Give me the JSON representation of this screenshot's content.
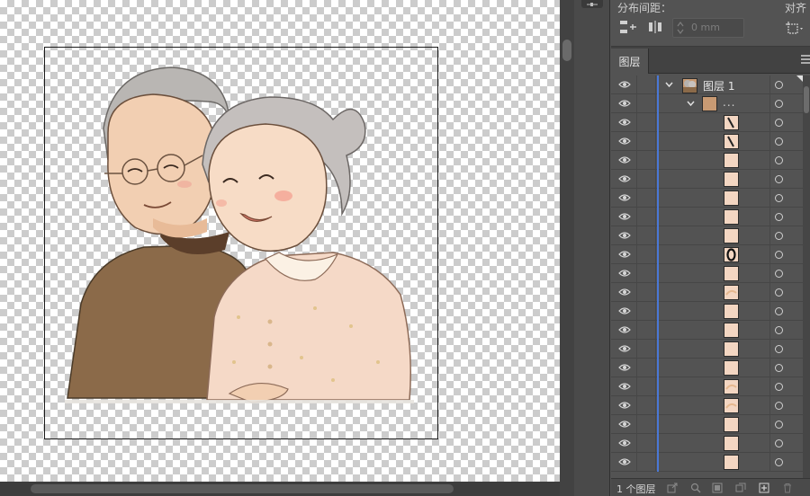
{
  "panel": {
    "distribute_spacing_title": "分布间距：",
    "align_to_title": "对齐",
    "spacing_value": "0 mm",
    "layers_tab": "图层",
    "layer_name": "图层 1",
    "group_name": "...",
    "layer_count": "1 个图层"
  },
  "icons": {
    "distribute_vertical": "distribute-vertical-space-icon",
    "distribute_horizontal": "distribute-horizontal-space-icon",
    "align_to": "align-to-artboard-icon",
    "visibility": "eye-icon",
    "target": "target-circle-icon",
    "footer": [
      "export-icon",
      "search-icon",
      "make-clipping-mask-icon",
      "new-sublayer-icon",
      "new-layer-icon",
      "delete-icon"
    ]
  },
  "colors": {
    "panel_bg": "#535353",
    "selection_bar": "#4a78d6",
    "thumbnail_skin": "#f3d6c2"
  },
  "layer_rows": [
    {
      "thumb": "stroke"
    },
    {
      "thumb": "stroke"
    },
    {
      "thumb": "fill"
    },
    {
      "thumb": "fill"
    },
    {
      "thumb": "fill"
    },
    {
      "thumb": "fill"
    },
    {
      "thumb": "fill"
    },
    {
      "thumb": "ring"
    },
    {
      "thumb": "fill"
    },
    {
      "thumb": "arc"
    },
    {
      "thumb": "fill"
    },
    {
      "thumb": "fill"
    },
    {
      "thumb": "fill"
    },
    {
      "thumb": "fill"
    },
    {
      "thumb": "arc"
    },
    {
      "thumb": "arc"
    },
    {
      "thumb": "fill"
    },
    {
      "thumb": "fill"
    },
    {
      "thumb": "fill"
    }
  ]
}
